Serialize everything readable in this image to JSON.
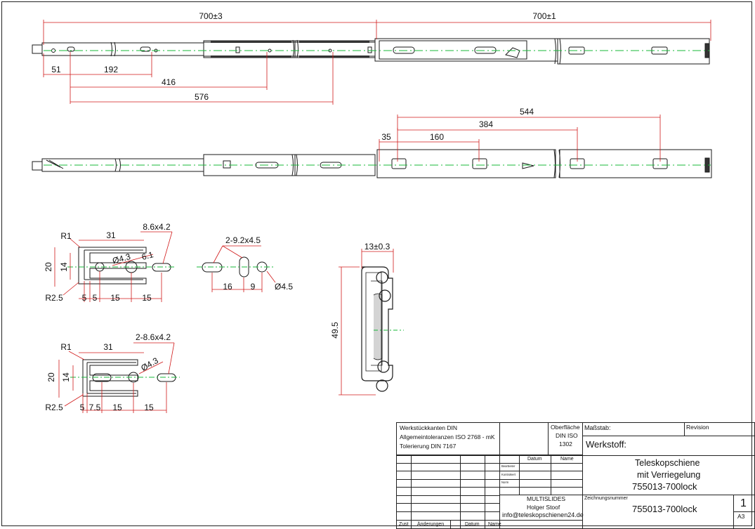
{
  "dimensions": {
    "top_total_left": "700±3",
    "top_total_right": "700±1",
    "top_d51": "51",
    "top_d192": "192",
    "top_d416": "416",
    "top_d576": "576",
    "side_d35": "35",
    "side_d160": "160",
    "side_d384": "384",
    "side_d544": "544",
    "detA_slot": "8.6x4.2",
    "detA_r1": "R1",
    "detA_31": "31",
    "detA_d43": "Ø4.3",
    "detA_61": "6.1",
    "detA_20": "20",
    "detA_14": "14",
    "detA_r25": "R2.5",
    "detA_5a": "5",
    "detA_5b": "5",
    "detA_15a": "15",
    "detA_15b": "15",
    "detB_slots": "2-9.2x4.5",
    "detB_16": "16",
    "detB_9": "9",
    "detB_d45": "Ø4.5",
    "detC_slots": "2-8.6x4.2",
    "detC_r1": "R1",
    "detC_31": "31",
    "detC_d43": "Ø4.3",
    "detC_20": "20",
    "detC_14": "14",
    "detC_r25": "R2.5",
    "detC_5": "5",
    "detC_75": "7.5",
    "detC_15a": "15",
    "detC_15b": "15",
    "sec_width": "13±0.3",
    "sec_height": "49.5"
  },
  "title_block": {
    "general_1": "Werkstückkanten DIN",
    "general_2": "Allgemeintoleranzen ISO 2768 - mK",
    "general_3": "Tolerierung DIN 7167",
    "surface_1": "Oberfläche",
    "surface_2": "DIN ISO",
    "surface_3": "1302",
    "scale_label": "Maßstab:",
    "revision_label": "Revision",
    "material_label": "Werkstoff:",
    "col_datum": "Datum",
    "col_name": "Name",
    "row_bearb": "Bearbeiter",
    "row_kontr": "Kontrolliert",
    "row_norm": "Norm",
    "title_1": "Teleskopschiene",
    "title_2": "mit Verriegelung",
    "title_3": "755013-700lock",
    "company": "MULTISLIDES",
    "person": "Holger Stoof",
    "email": "info@teleskopschienen24.de",
    "drawing_no_label": "Zeichnungsnummer",
    "drawing_no": "755013-700lock",
    "sheet": "1",
    "format": "A3",
    "foot_zust": "Zust",
    "foot_aend": "Änderungen",
    "foot_datum": "Datum",
    "foot_name": "Name"
  },
  "colors": {
    "dimension": "#d11a1a",
    "centerline": "#19b83a",
    "outline": "#1a1a1a"
  }
}
